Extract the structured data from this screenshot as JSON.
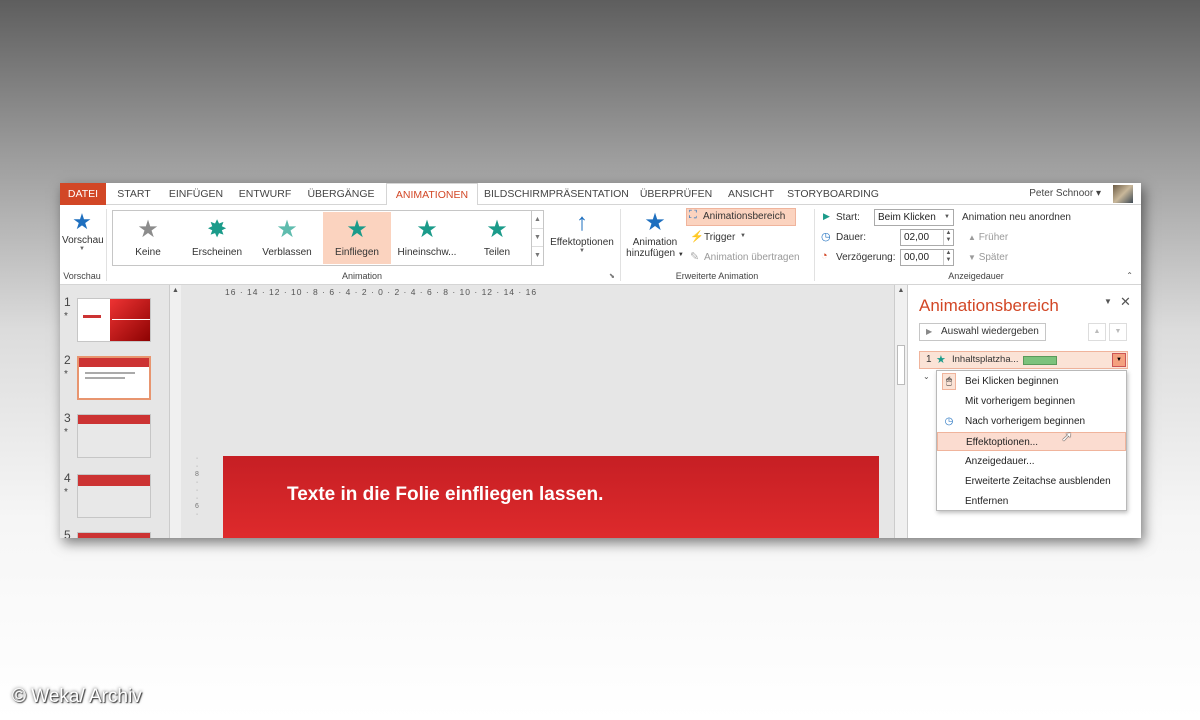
{
  "tabs": [
    "DATEI",
    "START",
    "EINFÜGEN",
    "ENTWURF",
    "ÜBERGÄNGE",
    "ANIMATIONEN",
    "BILDSCHIRMPRÄSENTATION",
    "ÜBERPRÜFEN",
    "ANSICHT",
    "STORYBOARDING"
  ],
  "user": {
    "name": "Peter Schnoor"
  },
  "ribbon": {
    "preview": {
      "label": "Vorschau",
      "group": "Vorschau"
    },
    "animations": [
      {
        "label": "Keine",
        "icon": "star-grey-icon"
      },
      {
        "label": "Erscheinen",
        "icon": "star-burst-icon"
      },
      {
        "label": "Verblassen",
        "icon": "star-fade-icon"
      },
      {
        "label": "Einfliegen",
        "icon": "star-fly-in-icon"
      },
      {
        "label": "Hineinschw...",
        "icon": "star-swivel-icon"
      },
      {
        "label": "Teilen",
        "icon": "star-split-icon"
      }
    ],
    "animation_group": "Animation",
    "effect_options": "Effektoptionen",
    "add_animation_1": "Animation",
    "add_animation_2": "hinzufügen",
    "animation_pane_btn": "Animationsbereich",
    "trigger": "Trigger",
    "animation_painter": "Animation übertragen",
    "advanced_group": "Erweiterte Animation",
    "start_label": "Start:",
    "start_value": "Beim Klicken",
    "duration_label": "Dauer:",
    "duration_value": "02,00",
    "delay_label": "Verzögerung:",
    "delay_value": "00,00",
    "timing_group": "Anzeigedauer",
    "reorder_title": "Animation neu anordnen",
    "earlier": "Früher",
    "later": "Später"
  },
  "thumbnails": [
    {
      "num": "1",
      "star": "*"
    },
    {
      "num": "2",
      "star": "*"
    },
    {
      "num": "3",
      "star": "*"
    },
    {
      "num": "4",
      "star": "*"
    },
    {
      "num": "5",
      "star": ""
    }
  ],
  "ruler_text": "16 · 14 · 12 · 10 · 8 · 6 · 4 · 2 · 0 · 2 · 4 · 6 · 8 · 10 · 12 · 14 · 16",
  "slide": {
    "title": "Texte in die Folie einfliegen lassen."
  },
  "pane": {
    "title": "Animationsbereich",
    "play_button": "Auswahl wiedergeben",
    "item_number": "1",
    "item_label": "Inhaltsplatzha..."
  },
  "context_menu": [
    "Bei Klicken beginnen",
    "Mit vorherigem beginnen",
    "Nach vorherigem beginnen",
    "Effektoptionen...",
    "Anzeigedauer...",
    "Erweiterte Zeitachse ausblenden",
    "Entfernen"
  ],
  "watermark": "© Weka/ Archiv",
  "colors": {
    "accent": "#d24726",
    "slide_red": "#c61f24",
    "teal": "#1b9b8a",
    "blue": "#1e6fbf"
  }
}
